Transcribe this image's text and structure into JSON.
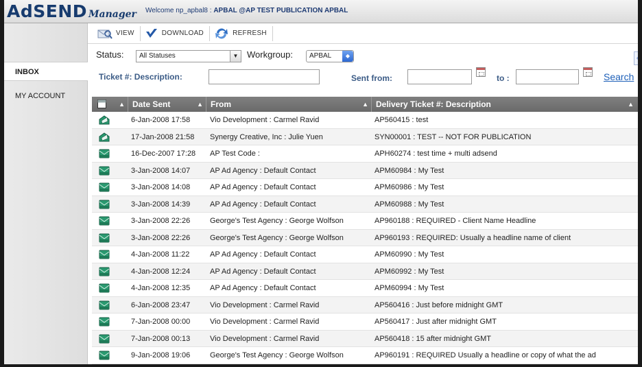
{
  "header": {
    "logo_main": "AdSEND",
    "logo_sub": "Manager",
    "welcome_prefix": "Welcome np_apbal8 : ",
    "welcome_pub": "APBAL @AP TEST PUBLICATION APBAL"
  },
  "sidebar": {
    "items": [
      {
        "label": "INBOX"
      },
      {
        "label": "MY ACCOUNT"
      }
    ]
  },
  "toolbar": {
    "view": "VIEW",
    "download": "DOWNLOAD",
    "refresh": "REFRESH"
  },
  "filters": {
    "status_label": "Status:",
    "status_value": "All Statuses",
    "workgroup_label": "Workgroup:",
    "workgroup_value": "APBAL",
    "ticket_label": "Ticket #: Description:",
    "sent_from_label": "Sent from:",
    "to_label": "to :",
    "search": "Search",
    "corner_button": "«R"
  },
  "table": {
    "columns": [
      "Date Sent",
      "From",
      "Delivery Ticket #: Description"
    ],
    "rows": [
      {
        "date": "6-Jan-2008 17:58",
        "from": "Vio Development : Carmel Ravid",
        "desc": "AP560415 : test",
        "icon": "opened"
      },
      {
        "date": "17-Jan-2008 21:58",
        "from": "Synergy Creative, Inc : Julie Yuen",
        "desc": "SYN00001 : TEST -- NOT FOR PUBLICATION",
        "icon": "opened"
      },
      {
        "date": "16-Dec-2007 17:28",
        "from": "AP Test Code :",
        "desc": "APH60274 : test time + multi adsend",
        "icon": "unread"
      },
      {
        "date": "3-Jan-2008 14:07",
        "from": "AP Ad Agency : Default Contact",
        "desc": "APM60984 : My Test",
        "icon": "unread"
      },
      {
        "date": "3-Jan-2008 14:08",
        "from": "AP Ad Agency : Default Contact",
        "desc": "APM60986 : My Test",
        "icon": "unread"
      },
      {
        "date": "3-Jan-2008 14:39",
        "from": "AP Ad Agency : Default Contact",
        "desc": "APM60988 : My Test",
        "icon": "unread"
      },
      {
        "date": "3-Jan-2008 22:26",
        "from": "George's Test Agency : George Wolfson",
        "desc": "AP960188 : REQUIRED - Client Name Headline",
        "icon": "unread"
      },
      {
        "date": "3-Jan-2008 22:26",
        "from": "George's Test Agency : George Wolfson",
        "desc": "AP960193 : REQUIRED: Usually a headline name of client",
        "icon": "unread"
      },
      {
        "date": "4-Jan-2008 11:22",
        "from": "AP Ad Agency : Default Contact",
        "desc": "APM60990 : My Test",
        "icon": "unread"
      },
      {
        "date": "4-Jan-2008 12:24",
        "from": "AP Ad Agency : Default Contact",
        "desc": "APM60992 : My Test",
        "icon": "unread"
      },
      {
        "date": "4-Jan-2008 12:35",
        "from": "AP Ad Agency : Default Contact",
        "desc": "APM60994 : My Test",
        "icon": "unread"
      },
      {
        "date": "6-Jan-2008 23:47",
        "from": "Vio Development : Carmel Ravid",
        "desc": "AP560416 : Just before midnight GMT",
        "icon": "unread"
      },
      {
        "date": "7-Jan-2008 00:00",
        "from": "Vio Development : Carmel Ravid",
        "desc": "AP560417 : Just after midnight GMT",
        "icon": "unread"
      },
      {
        "date": "7-Jan-2008 00:13",
        "from": "Vio Development : Carmel Ravid",
        "desc": "AP560418 : 15 after midnight GMT",
        "icon": "unread"
      },
      {
        "date": "9-Jan-2008 19:06",
        "from": "George's Test Agency : George Wolfson",
        "desc": "AP960191 : REQUIRED Usually a headline or copy of what the ad",
        "icon": "unread"
      }
    ]
  },
  "colors": {
    "brand": "#173b6e",
    "header_bg": "#6f6f6f",
    "link": "#1d5fb8",
    "envelope": "#1e8f6a"
  }
}
